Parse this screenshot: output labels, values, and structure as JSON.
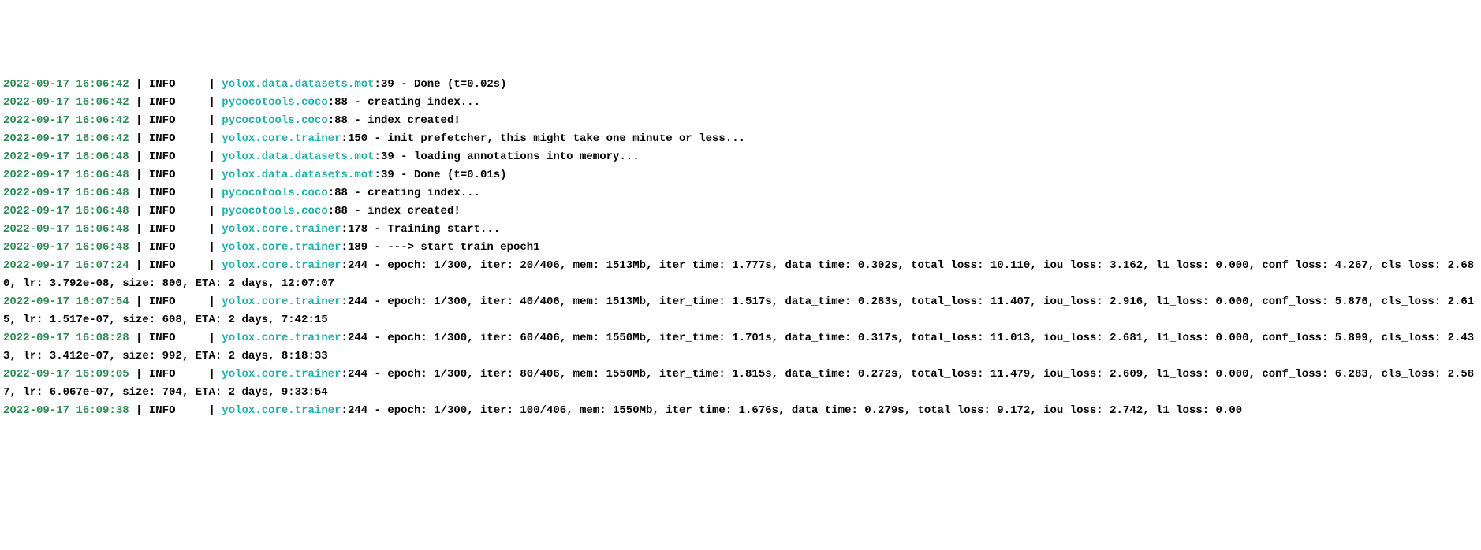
{
  "log_entries": [
    {
      "ts": "2022-09-17 16:06:42",
      "level": "INFO",
      "module": "yolox.data.datasets.mot",
      "line": "39",
      "msg": "Done (t=0.02s)"
    },
    {
      "ts": "2022-09-17 16:06:42",
      "level": "INFO",
      "module": "pycocotools.coco",
      "line": "88",
      "msg": "creating index..."
    },
    {
      "ts": "2022-09-17 16:06:42",
      "level": "INFO",
      "module": "pycocotools.coco",
      "line": "88",
      "msg": "index created!"
    },
    {
      "ts": "2022-09-17 16:06:42",
      "level": "INFO",
      "module": "yolox.core.trainer",
      "line": "150",
      "msg": "init prefetcher, this might take one minute or less..."
    },
    {
      "ts": "2022-09-17 16:06:48",
      "level": "INFO",
      "module": "yolox.data.datasets.mot",
      "line": "39",
      "msg": "loading annotations into memory..."
    },
    {
      "ts": "2022-09-17 16:06:48",
      "level": "INFO",
      "module": "yolox.data.datasets.mot",
      "line": "39",
      "msg": "Done (t=0.01s)"
    },
    {
      "ts": "2022-09-17 16:06:48",
      "level": "INFO",
      "module": "pycocotools.coco",
      "line": "88",
      "msg": "creating index..."
    },
    {
      "ts": "2022-09-17 16:06:48",
      "level": "INFO",
      "module": "pycocotools.coco",
      "line": "88",
      "msg": "index created!"
    },
    {
      "ts": "2022-09-17 16:06:48",
      "level": "INFO",
      "module": "yolox.core.trainer",
      "line": "178",
      "msg": "Training start..."
    },
    {
      "ts": "2022-09-17 16:06:48",
      "level": "INFO",
      "module": "yolox.core.trainer",
      "line": "189",
      "msg": "---> start train epoch1"
    },
    {
      "ts": "2022-09-17 16:07:24",
      "level": "INFO",
      "module": "yolox.core.trainer",
      "line": "244",
      "msg": "epoch: 1/300, iter: 20/406, mem: 1513Mb, iter_time: 1.777s, data_time: 0.302s, total_loss: 10.110, iou_loss: 3.162, l1_loss: 0.000, conf_loss: 4.267, cls_loss: 2.680, lr: 3.792e-08, size: 800, ETA: 2 days, 12:07:07"
    },
    {
      "ts": "2022-09-17 16:07:54",
      "level": "INFO",
      "module": "yolox.core.trainer",
      "line": "244",
      "msg": "epoch: 1/300, iter: 40/406, mem: 1513Mb, iter_time: 1.517s, data_time: 0.283s, total_loss: 11.407, iou_loss: 2.916, l1_loss: 0.000, conf_loss: 5.876, cls_loss: 2.615, lr: 1.517e-07, size: 608, ETA: 2 days, 7:42:15"
    },
    {
      "ts": "2022-09-17 16:08:28",
      "level": "INFO",
      "module": "yolox.core.trainer",
      "line": "244",
      "msg": "epoch: 1/300, iter: 60/406, mem: 1550Mb, iter_time: 1.701s, data_time: 0.317s, total_loss: 11.013, iou_loss: 2.681, l1_loss: 0.000, conf_loss: 5.899, cls_loss: 2.433, lr: 3.412e-07, size: 992, ETA: 2 days, 8:18:33"
    },
    {
      "ts": "2022-09-17 16:09:05",
      "level": "INFO",
      "module": "yolox.core.trainer",
      "line": "244",
      "msg": "epoch: 1/300, iter: 80/406, mem: 1550Mb, iter_time: 1.815s, data_time: 0.272s, total_loss: 11.479, iou_loss: 2.609, l1_loss: 0.000, conf_loss: 6.283, cls_loss: 2.587, lr: 6.067e-07, size: 704, ETA: 2 days, 9:33:54"
    },
    {
      "ts": "2022-09-17 16:09:38",
      "level": "INFO",
      "module": "yolox.core.trainer",
      "line": "244",
      "msg": "epoch: 1/300, iter: 100/406, mem: 1550Mb, iter_time: 1.676s, data_time: 0.279s, total_loss: 9.172, iou_loss: 2.742, l1_loss: 0.00"
    }
  ],
  "watermark": ""
}
